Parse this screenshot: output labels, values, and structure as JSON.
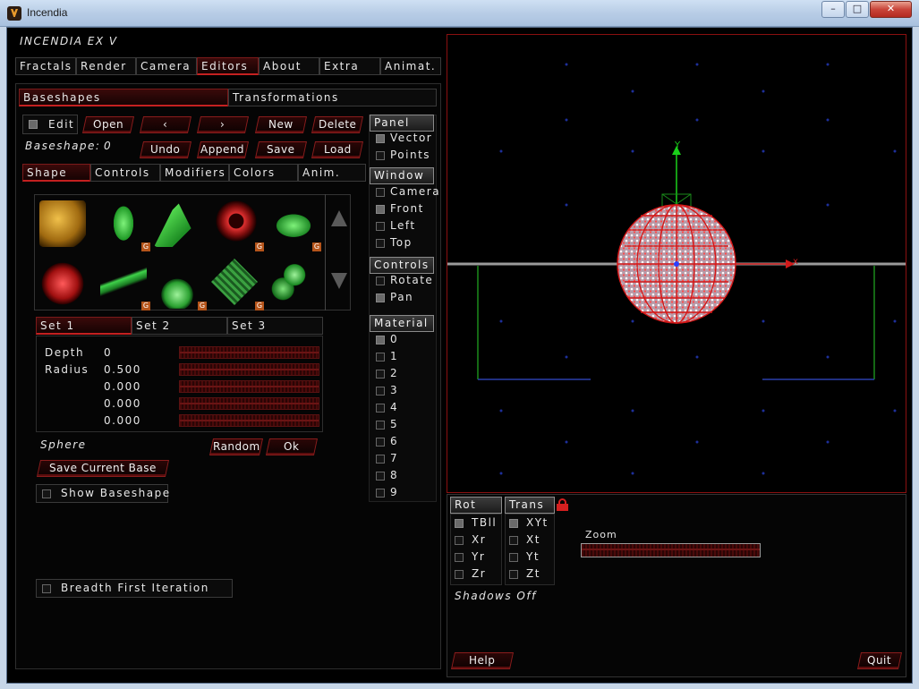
{
  "window": {
    "title": "Incendia"
  },
  "app": {
    "name": "INCENDIA EX V"
  },
  "main_tabs": [
    {
      "label": "Fractals"
    },
    {
      "label": "Render"
    },
    {
      "label": "Camera"
    },
    {
      "label": "Editors"
    },
    {
      "label": "About"
    },
    {
      "label": "Extra"
    },
    {
      "label": "Animat."
    }
  ],
  "sub_tabs": [
    {
      "label": "Baseshapes"
    },
    {
      "label": "Transformations"
    }
  ],
  "toolbar": {
    "edit": "Edit",
    "open": "Open",
    "prev": "‹",
    "next": "›",
    "new": "New",
    "delete": "Delete",
    "undo": "Undo",
    "append": "Append",
    "save": "Save",
    "load": "Load"
  },
  "baseshape": {
    "label": "Baseshape:",
    "value": "0"
  },
  "shape_tabs": [
    {
      "label": "Shape"
    },
    {
      "label": "Controls"
    },
    {
      "label": "Modifiers"
    },
    {
      "label": "Colors"
    },
    {
      "label": "Anim."
    }
  ],
  "thumb_badge": "G",
  "set_tabs": [
    {
      "label": "Set 1"
    },
    {
      "label": "Set 2"
    },
    {
      "label": "Set 3"
    }
  ],
  "params": [
    {
      "label": "Depth",
      "value": "0"
    },
    {
      "label": "Radius",
      "value": "0.500"
    },
    {
      "label": "",
      "value": "0.000"
    },
    {
      "label": "",
      "value": "0.000"
    },
    {
      "label": "",
      "value": "0.000"
    }
  ],
  "shape_name": "Sphere",
  "random": "Random",
  "ok": "Ok",
  "save_current_base": "Save Current Base",
  "show_baseshape": "Show Baseshape",
  "breadth_first": "Breadth First Iteration",
  "side": {
    "panel": {
      "title": "Panel",
      "items": [
        {
          "label": "Vector",
          "checked": true
        },
        {
          "label": "Points",
          "checked": false
        }
      ]
    },
    "window": {
      "title": "Window",
      "items": [
        {
          "label": "Camera",
          "checked": false
        },
        {
          "label": "Front",
          "checked": true
        },
        {
          "label": "Left",
          "checked": false
        },
        {
          "label": "Top",
          "checked": false
        }
      ]
    },
    "controls": {
      "title": "Controls",
      "items": [
        {
          "label": "Rotate",
          "checked": false
        },
        {
          "label": "Pan",
          "checked": true
        }
      ]
    },
    "material": {
      "title": "Material",
      "items": [
        {
          "label": "0",
          "checked": true
        },
        {
          "label": "1",
          "checked": false
        },
        {
          "label": "2",
          "checked": false
        },
        {
          "label": "3",
          "checked": false
        },
        {
          "label": "4",
          "checked": false
        },
        {
          "label": "5",
          "checked": false
        },
        {
          "label": "6",
          "checked": false
        },
        {
          "label": "7",
          "checked": false
        },
        {
          "label": "8",
          "checked": false
        },
        {
          "label": "9",
          "checked": false
        }
      ]
    }
  },
  "viewport": {
    "axis_y": "Y",
    "axis_x": "x"
  },
  "bottom": {
    "rot": {
      "title": "Rot",
      "items": [
        {
          "label": "TBll",
          "checked": true
        },
        {
          "label": "Xr",
          "checked": false
        },
        {
          "label": "Yr",
          "checked": false
        },
        {
          "label": "Zr",
          "checked": false
        }
      ]
    },
    "trans": {
      "title": "Trans",
      "items": [
        {
          "label": "XYt",
          "checked": true
        },
        {
          "label": "Xt",
          "checked": false
        },
        {
          "label": "Yt",
          "checked": false
        },
        {
          "label": "Zt",
          "checked": false
        }
      ]
    },
    "zoom": "Zoom",
    "shadows": "Shadows  Off",
    "help": "Help",
    "quit": "Quit"
  },
  "colors": {
    "accent": "#c42020",
    "background": "#000000"
  }
}
